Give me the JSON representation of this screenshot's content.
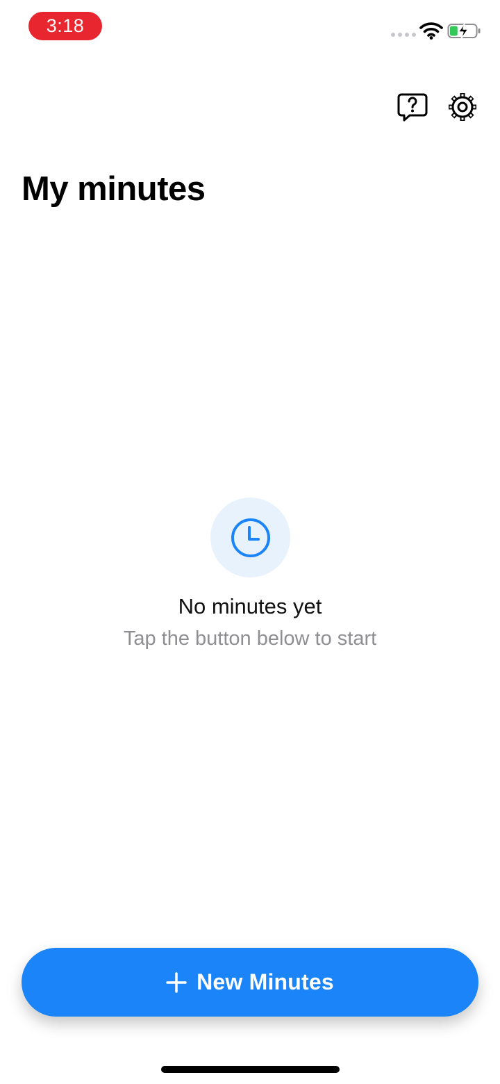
{
  "status_bar": {
    "time": "3:18",
    "time_pill_color": "#e8262f",
    "icons": [
      "signal-dots-icon",
      "wifi-icon",
      "battery-charging-icon"
    ],
    "battery_level": 0.3
  },
  "toolbar": {
    "icons": [
      "help-bubble-icon",
      "gear-icon"
    ]
  },
  "header": {
    "title": "My minutes"
  },
  "empty_state": {
    "icon": "clock-icon",
    "title": "No minutes yet",
    "subtitle": "Tap the button below to start"
  },
  "footer": {
    "new_button_label": "New Minutes",
    "new_button_icon": "plus-icon"
  },
  "colors": {
    "accent": "#1a84f8",
    "accent_light": "#e8f2fd",
    "subtitle": "#8e8e93",
    "battery_green": "#34c759"
  }
}
